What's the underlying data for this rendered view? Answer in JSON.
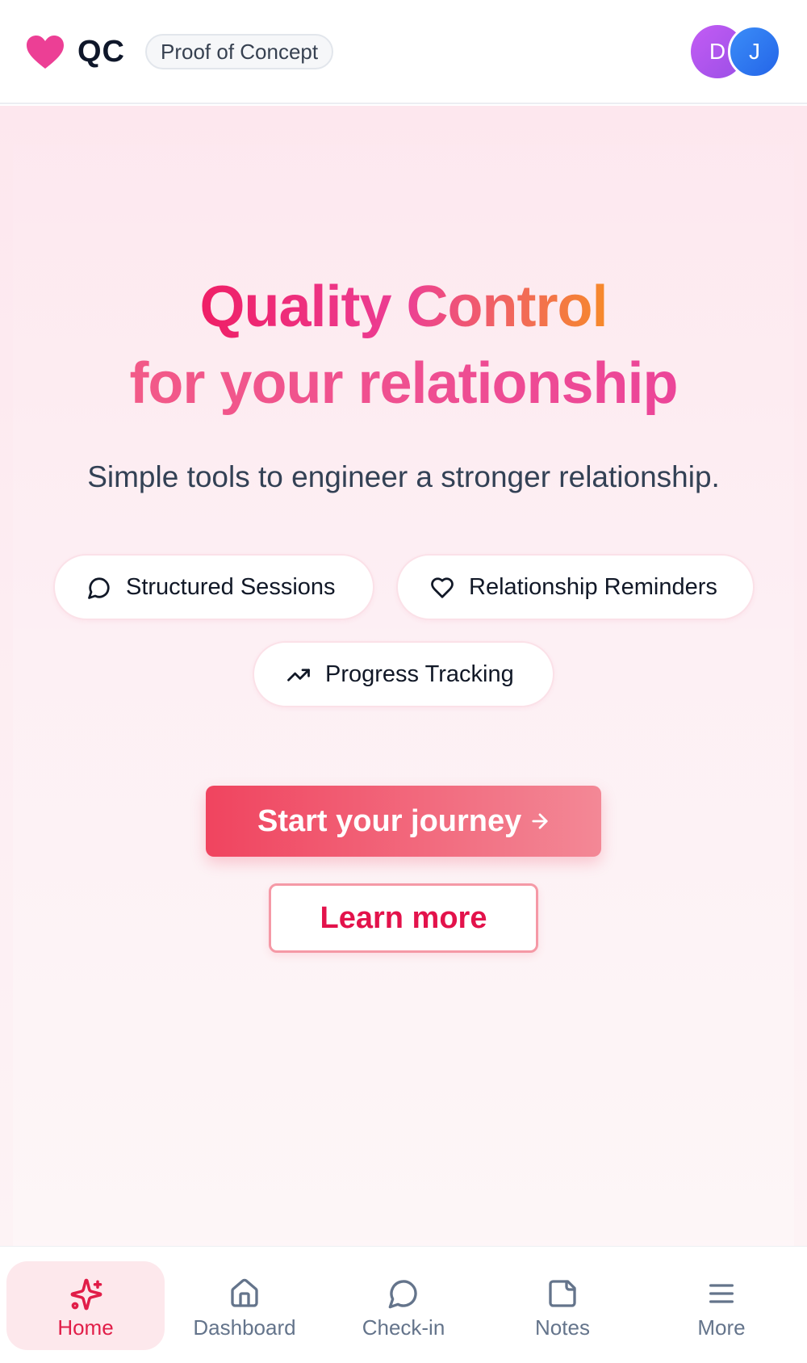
{
  "header": {
    "brand": "QC",
    "badge": "Proof of Concept",
    "avatars": [
      {
        "initial": "D",
        "color": "#b45af2"
      },
      {
        "initial": "J",
        "color": "#2f7bf3"
      }
    ]
  },
  "hero": {
    "title_line1": "Quality Control",
    "title_line2": "for your relationship",
    "subtitle": "Simple tools to engineer a stronger relationship.",
    "features": [
      {
        "icon": "chat-bubble-icon",
        "label": "Structured Sessions"
      },
      {
        "icon": "heart-outline-icon",
        "label": "Relationship Reminders"
      },
      {
        "icon": "trending-up-icon",
        "label": "Progress Tracking"
      }
    ],
    "primary_cta": "Start your journey",
    "secondary_cta": "Learn more"
  },
  "nav": {
    "items": [
      {
        "icon": "sparkles-icon",
        "label": "Home",
        "active": true
      },
      {
        "icon": "home-icon",
        "label": "Dashboard",
        "active": false
      },
      {
        "icon": "chat-bubble-icon",
        "label": "Check-in",
        "active": false
      },
      {
        "icon": "note-icon",
        "label": "Notes",
        "active": false
      },
      {
        "icon": "menu-icon",
        "label": "More",
        "active": false
      }
    ]
  },
  "colors": {
    "brand_pink": "#ec3f95",
    "accent_red": "#e11d48",
    "cta_gradient_start": "#f0445f",
    "cta_gradient_end": "#f38896"
  }
}
